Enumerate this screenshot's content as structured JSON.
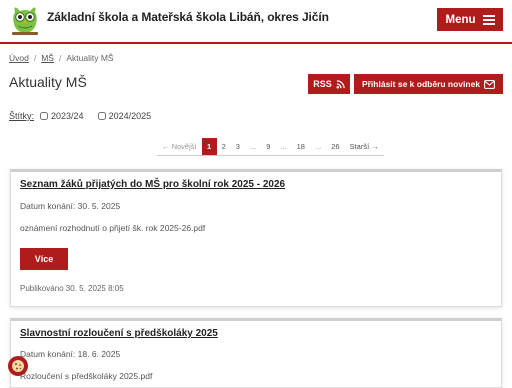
{
  "header": {
    "site_title": "Základní škola a Mateřská škola Libáň, okres Jičín",
    "menu_label": "Menu"
  },
  "breadcrumb": {
    "items": [
      "Úvod",
      "MŠ",
      "Aktuality MŠ"
    ],
    "separator": "/"
  },
  "page": {
    "title": "Aktuality MŠ"
  },
  "actions": {
    "rss_label": "RSS",
    "subscribe_label": "Přihlásit se k odběru novinek"
  },
  "tags": {
    "label": "Štítky:",
    "options": [
      {
        "label": "2023/24",
        "checked": false
      },
      {
        "label": "2024/2025",
        "checked": false
      }
    ]
  },
  "pagination": {
    "prev": "← Novější",
    "pages": [
      "1",
      "2",
      "3",
      "...",
      "9",
      "...",
      "18",
      "...",
      "26"
    ],
    "current": "1",
    "next": "Starší →"
  },
  "articles": [
    {
      "title": "Seznam žáků přijatých do MŠ pro školní rok 2025 - 2026",
      "date": "Datum konání: 30. 5. 2025",
      "description": "oznámení rozhodnutí o přijetí šk. rok 2025-26.pdf",
      "more_label": "Více",
      "published": "Publikováno 30. 5. 2025 8:05"
    },
    {
      "title": "Slavnostní rozloučení s předškoláky 2025",
      "date": "Datum konání: 18. 6. 2025",
      "description": "Rozloučení s předškoláky 2025.pdf"
    }
  ],
  "colors": {
    "accent": "#b01c1c",
    "logo_green": "#7cc242"
  },
  "icons": {
    "logo": "owl-logo",
    "menu": "hamburger-icon",
    "rss": "rss-icon",
    "subscribe": "envelope-icon",
    "cookie": "cookie-icon"
  }
}
